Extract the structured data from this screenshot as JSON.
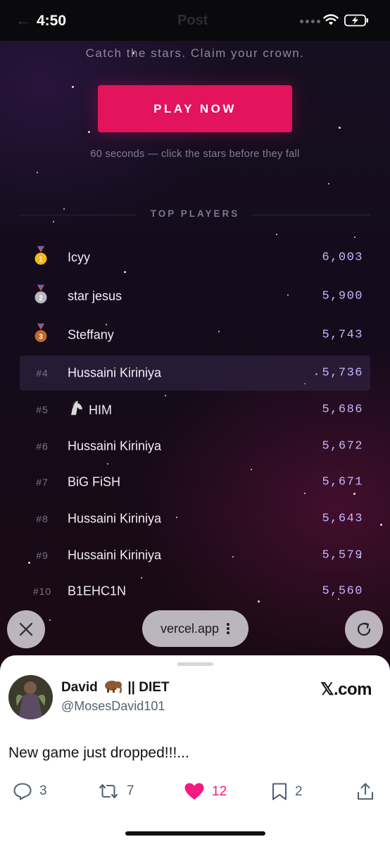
{
  "status_bar": {
    "time": "4:50",
    "title": "Post",
    "icons": [
      "back-arrow-icon",
      "signal-dots-icon",
      "wifi-icon",
      "battery-charging-icon"
    ]
  },
  "game": {
    "tagline": "Catch the stars. Claim your crown.",
    "play_label": "PLAY NOW",
    "hint": "60 seconds — click the stars before they fall",
    "leaderboard_title": "TOP PLAYERS",
    "players": [
      {
        "rank": "",
        "medal": "gold",
        "name": "Icyy",
        "score": "6,003"
      },
      {
        "rank": "",
        "medal": "silver",
        "name": "star jesus",
        "score": "5,900"
      },
      {
        "rank": "",
        "medal": "bronze",
        "name": "Steffany",
        "score": "5,743"
      },
      {
        "rank": "#4",
        "medal": "",
        "name": "Hussaini Kiriniya",
        "score": "5,736",
        "highlighted": true
      },
      {
        "rank": "#5",
        "medal": "",
        "name": "HIM",
        "score": "5,686",
        "prefix_icon": "horse-icon"
      },
      {
        "rank": "#6",
        "medal": "",
        "name": "Hussaini Kiriniya",
        "score": "5,672"
      },
      {
        "rank": "#7",
        "medal": "",
        "name": "BiG FiSH",
        "score": "5,671"
      },
      {
        "rank": "#8",
        "medal": "",
        "name": "Hussaini Kiriniya",
        "score": "5,643"
      },
      {
        "rank": "#9",
        "medal": "",
        "name": "Hussaini Kiriniya",
        "score": "5,579"
      },
      {
        "rank": "#10",
        "medal": "",
        "name": "B1EHC1N",
        "score": "5,560"
      }
    ],
    "colors": {
      "accent": "#e3135c",
      "score": "#c4b7ff"
    }
  },
  "browser": {
    "url": "vercel.app",
    "icons": [
      "close-icon",
      "more-vertical-icon",
      "reload-icon"
    ]
  },
  "post": {
    "author_name_before": "David",
    "author_name_after": "|| DIET",
    "author_emoji_icon": "mammoth-icon",
    "handle": "@MosesDavid101",
    "site": "𝕏.com",
    "text": "New game just dropped!!!...",
    "actions": {
      "replies": "3",
      "reposts": "7",
      "likes": "12",
      "bookmarks": "2"
    },
    "like_color": "#f91880"
  }
}
